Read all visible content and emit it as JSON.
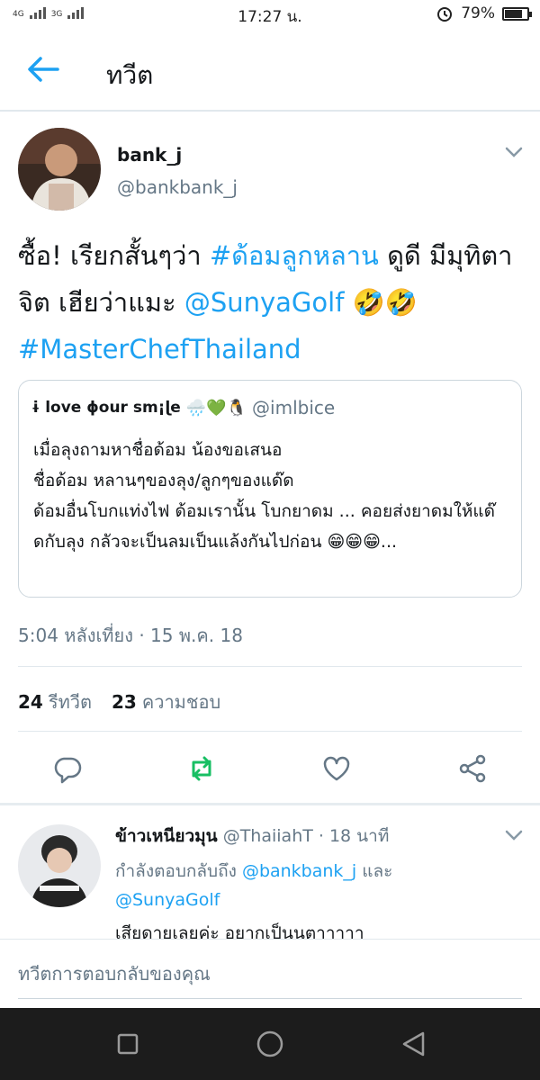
{
  "status_bar": {
    "network_1": "4G",
    "network_2": "3G",
    "time": "17:27 น.",
    "battery": "79%",
    "battery_level": 0.79
  },
  "header": {
    "title": "ทวีต"
  },
  "tweet": {
    "author_name": "bank_j",
    "author_handle": "@bankbank_j",
    "text_parts": {
      "p1": "ซื้อ! เรียกสั้นๆว่า ",
      "tag1": "#ด้อมลูกหลาน",
      "p2": " ดูดี มีมุทิตาจิต เฮียว่าแมะ ",
      "mention": "@SunyaGolf",
      "p3": " 🤣🤣 ",
      "tag2": "#MasterChefThailand"
    },
    "quote": {
      "name": "ɨ love ɸour sm¡ɭe",
      "emojis": "🌧️💚🐧",
      "handle": "@imlbice",
      "text": "เมื่อลุงถามหาชื่อด้อม น้องขอเสนอ\nชื่อด้อม หลานๆของลุง/ลูกๆของแด๊ด\nด้อมอื่นโบกแท่งไฟ ด้อมเรานั้น โบกยาดม ... คอยส่งยาดมให้แด๊ดกับลุง กลัวจะเป็นลมเป็นแล้งกันไปก่อน 😁😁😁..."
    },
    "timestamp": "5:04 หลังเที่ยง · 15 พ.ค. 18",
    "retweets_count": "24",
    "retweets_label": "รีทวีต",
    "likes_count": "23",
    "likes_label": "ความชอบ"
  },
  "reply": {
    "author_name": "ข้าวเหนียวมุน",
    "author_handle": "@ThaiiahT",
    "time": "· 18 นาที",
    "replying_prefix": "กำลังตอบกลับถึง ",
    "replying_user1": "@bankbank_j",
    "replying_and": " และ ",
    "replying_user2": "@SunyaGolf",
    "body": "เสียดายเลยค่ะ อยากเป็นนตาาาาา"
  },
  "compose": {
    "placeholder": "ทวีตการตอบกลับของคุณ"
  },
  "colors": {
    "accent": "#1da1f2",
    "retweet": "#17bf63",
    "muted": "#657786"
  }
}
